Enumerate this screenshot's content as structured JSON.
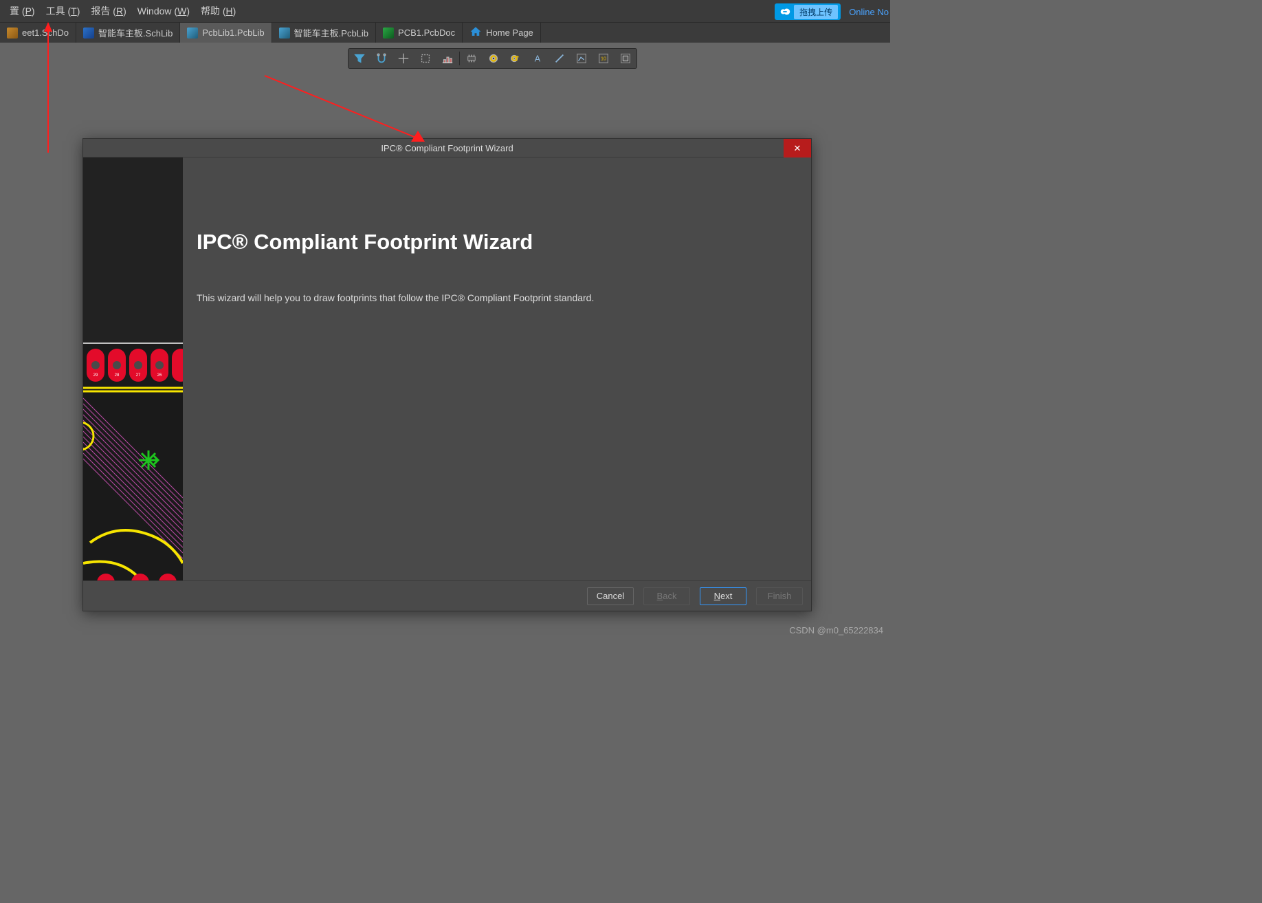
{
  "menu": {
    "items": [
      {
        "label": "置 (",
        "mn": "P",
        "tail": ")"
      },
      {
        "label": "工具 (",
        "mn": "T",
        "tail": ")"
      },
      {
        "label": "报告 (",
        "mn": "R",
        "tail": ")"
      },
      {
        "label": "Window (",
        "mn": "W",
        "tail": ")"
      },
      {
        "label": "帮助 (",
        "mn": "H",
        "tail": ")"
      }
    ]
  },
  "cloud": {
    "button_label": "拖拽上传",
    "online_label": "Online No"
  },
  "tabs": {
    "items": [
      {
        "icon": "ico-sch",
        "label": "eet1.SchDo"
      },
      {
        "icon": "ico-sch2",
        "label": "智能车主板.SchLib"
      },
      {
        "icon": "ico-pcblib",
        "label": "PcbLib1.PcbLib",
        "active": true
      },
      {
        "icon": "ico-pcblib",
        "label": "智能车主板.PcbLib"
      },
      {
        "icon": "ico-pcb",
        "label": "PCB1.PcbDoc"
      },
      {
        "icon": "home",
        "label": "Home Page"
      }
    ]
  },
  "toolbar": {
    "items": [
      "filter-icon",
      "snap-icon",
      "crosshair-icon",
      "select-rect-icon",
      "align-icon",
      "sep",
      "ic-icon",
      "pad-circle-icon",
      "via-icon",
      "text-icon",
      "line-icon",
      "polyline-icon",
      "dimension-icon",
      "layer-icon"
    ]
  },
  "modal": {
    "title": "IPC® Compliant Footprint Wizard",
    "heading": "IPC® Compliant Footprint Wizard",
    "desc": "This wizard will help you to draw footprints that follow the IPC® Compliant Footprint standard.",
    "close_icon": "✕",
    "buttons": {
      "cancel": "Cancel",
      "back_pre": "",
      "back_mn": "B",
      "back_post": "ack",
      "next_pre": "",
      "next_mn": "N",
      "next_post": "ext",
      "finish": "Finish"
    }
  },
  "watermark": "CSDN @m0_65222834"
}
